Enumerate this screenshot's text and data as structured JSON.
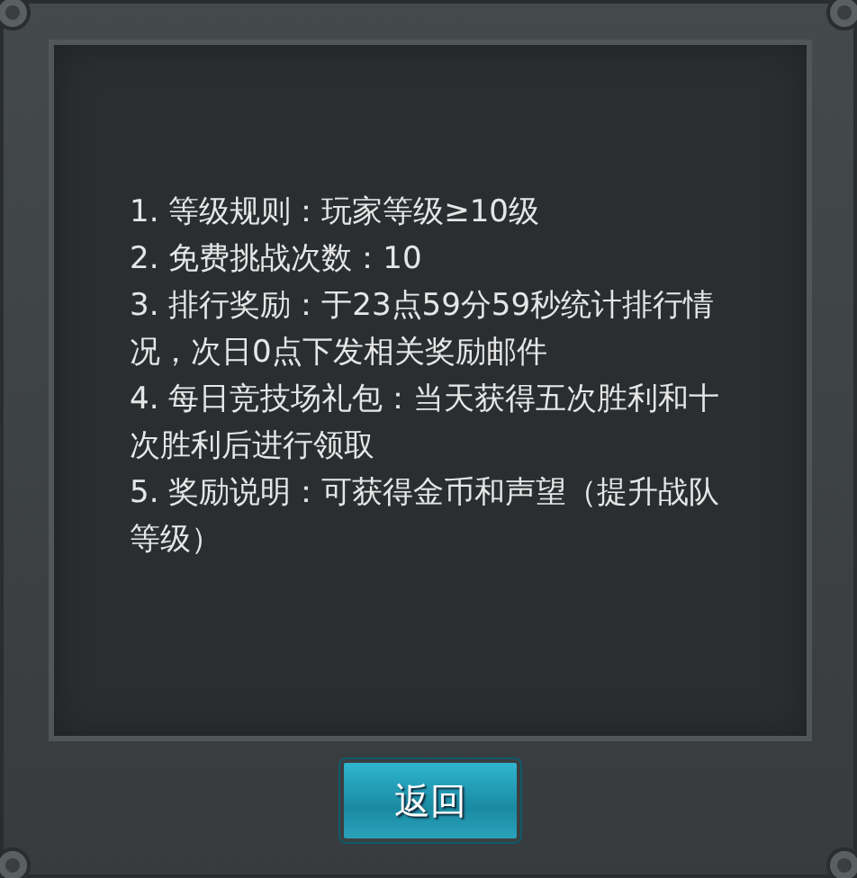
{
  "rules": [
    {
      "text": "1. 等级规则：玩家等级≥10级"
    },
    {
      "text": "2. 免费挑战次数：10"
    },
    {
      "text": "3. 排行奖励：于23点59分59秒统计排行情况，次日0点下发相关奖励邮件"
    },
    {
      "text": "4. 每日竞技场礼包：当天获得五次胜利和十次胜利后进行领取"
    },
    {
      "text": "5. 奖励说明：可获得金币和声望（提升战队等级）"
    }
  ],
  "button": {
    "label": "返回"
  }
}
